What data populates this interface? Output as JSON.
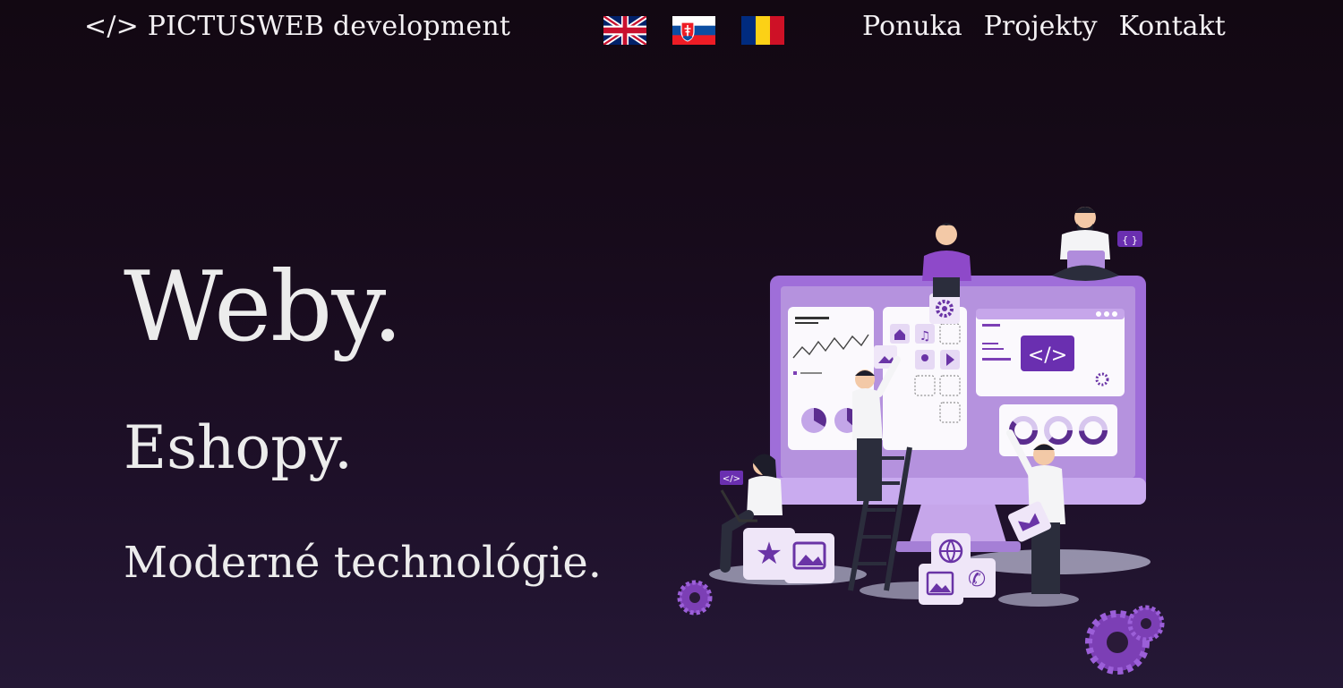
{
  "header": {
    "brand": "</> PICTUSWEB development",
    "flags": [
      {
        "name": "english-flag-icon"
      },
      {
        "name": "slovak-flag-icon"
      },
      {
        "name": "romanian-flag-icon"
      }
    ],
    "nav": [
      {
        "label": "Ponuka"
      },
      {
        "label": "Projekty"
      },
      {
        "label": "Kontakt"
      }
    ]
  },
  "hero": {
    "headline": "Weby.",
    "subheadline": "Eshopy.",
    "tagline": "Moderné technológie."
  },
  "illustration": {
    "code_badge": "</>",
    "braces_badge": "{ }"
  },
  "colors": {
    "background_top": "#120812",
    "background_bottom": "#251836",
    "accent": "#7c3fb5",
    "screen": "#b592de",
    "text": "#ececec"
  }
}
